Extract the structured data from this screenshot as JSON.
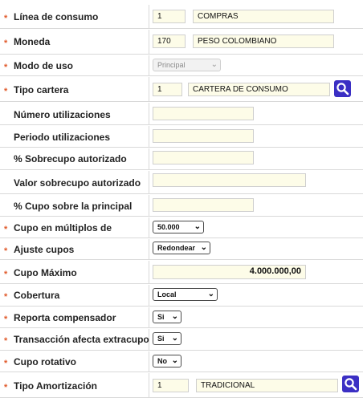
{
  "rows": {
    "linea_consumo": {
      "label": "Línea de consumo",
      "code": "1",
      "desc": "COMPRAS"
    },
    "moneda": {
      "label": "Moneda",
      "code": "170",
      "desc": "PESO COLOMBIANO"
    },
    "modo_uso": {
      "label": "Modo de uso",
      "selected": "Principal"
    },
    "tipo_cartera": {
      "label": "Tipo cartera",
      "code": "1",
      "desc": "CARTERA DE CONSUMO"
    },
    "numero_utilizaciones": {
      "label": "Número utilizaciones",
      "value": ""
    },
    "periodo_utilizaciones": {
      "label": "Periodo utilizaciones",
      "value": ""
    },
    "sobrecupo_pct": {
      "label": "% Sobrecupo autorizado",
      "value": ""
    },
    "valor_sobrecupo": {
      "label": "Valor sobrecupo autorizado",
      "value": ""
    },
    "cupo_principal_pct": {
      "label": "% Cupo sobre la principal",
      "value": ""
    },
    "cupo_multiplos": {
      "label": "Cupo en múltiplos de",
      "selected": "50.000"
    },
    "ajuste_cupos": {
      "label": "Ajuste cupos",
      "selected": "Redondear"
    },
    "cupo_maximo": {
      "label": "Cupo Máximo",
      "value": "4.000.000,00"
    },
    "cobertura": {
      "label": "Cobertura",
      "selected": "Local"
    },
    "reporta_compensador": {
      "label": "Reporta compensador",
      "selected": "Si"
    },
    "transaccion_extracupo": {
      "label": "Transacción afecta extracupo",
      "selected": "Si"
    },
    "cupo_rotativo": {
      "label": "Cupo rotativo",
      "selected": "No"
    },
    "tipo_amortizacion": {
      "label": "Tipo Amortización",
      "code": "1",
      "desc": "TRADICIONAL"
    }
  },
  "required_marker": "*",
  "icons": {
    "search": "search-icon",
    "dropdown": "chevron-down-icon"
  },
  "colors": {
    "accent": "#3b2fc4",
    "required": "#e0592a",
    "field_bg": "#fdfce8"
  }
}
